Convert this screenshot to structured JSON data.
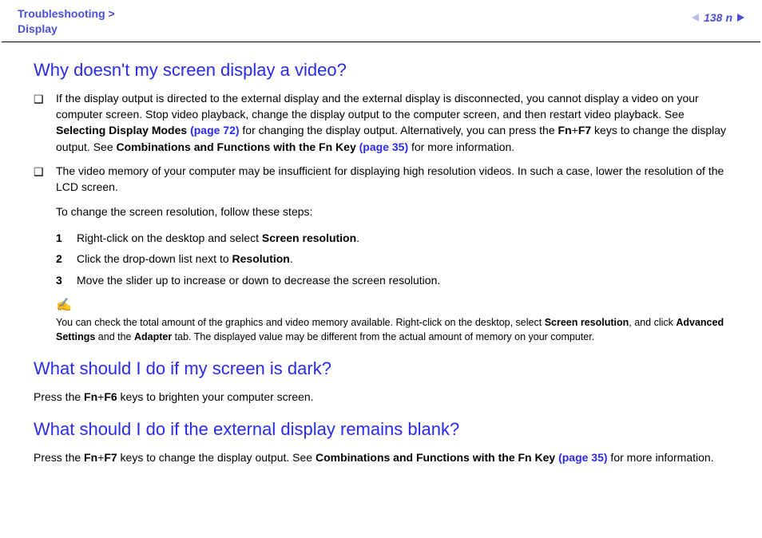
{
  "header": {
    "breadcrumb_line1": "Troubleshooting >",
    "breadcrumb_line2": "Display",
    "page_number": "138",
    "page_number_label": "n"
  },
  "sections": {
    "s1": {
      "title": "Why doesn't my screen display a video?",
      "bullets": {
        "b1": {
          "pre": "If the display output is directed to the external display and the external display is disconnected, you cannot display a video on your computer screen. Stop video playback, change the display output to the computer screen, and then restart video playback. See ",
          "bold1": "Selecting Display Modes ",
          "link1": "(page 72)",
          "mid1": " for changing the display output. Alternatively, you can press the ",
          "bold2": "Fn",
          "plus1": "+",
          "bold3": "F7",
          "mid2": " keys to change the display output. See ",
          "bold4": "Combinations and Functions with the Fn Key ",
          "link2": "(page 35)",
          "post": " for more information."
        },
        "b2": "The video memory of your computer may be insufficient for displaying high resolution videos. In such a case, lower the resolution of the LCD screen."
      },
      "sub1": "To change the screen resolution, follow these steps:",
      "steps": {
        "n1": "1",
        "t1a": "Right-click on the desktop and select ",
        "t1b": "Screen resolution",
        "t1c": ".",
        "n2": "2",
        "t2a": "Click the drop-down list next to ",
        "t2b": "Resolution",
        "t2c": ".",
        "n3": "3",
        "t3": "Move the slider up to increase or down to decrease the screen resolution."
      },
      "note_icon": "✍",
      "note": {
        "a": "You can check the total amount of the graphics and video memory available. Right-click on the desktop, select ",
        "b1": "Screen resolution",
        "b": ", and click ",
        "b2": "Advanced Settings",
        "c": " and the ",
        "b3": "Adapter",
        "d": " tab. The displayed value may be different from the actual amount of memory on your computer."
      }
    },
    "s2": {
      "title": "What should I do if my screen is dark?",
      "p": {
        "a": "Press the ",
        "b1": "Fn",
        "plus": "+",
        "b2": "F6",
        "c": " keys to brighten your computer screen."
      }
    },
    "s3": {
      "title": "What should I do if the external display remains blank?",
      "p": {
        "a": "Press the ",
        "b1": "Fn",
        "plus": "+",
        "b2": "F7",
        "c": " keys to change the display output. See ",
        "b3": "Combinations and Functions with the Fn Key ",
        "link": "(page 35)",
        "d": " for more information."
      }
    }
  }
}
